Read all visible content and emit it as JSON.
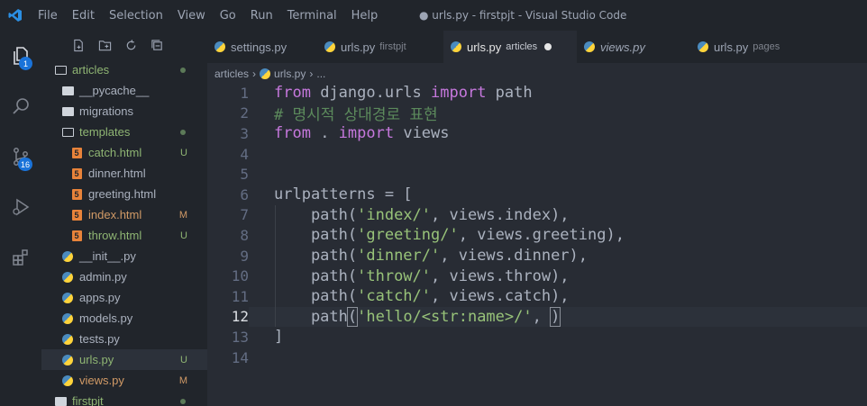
{
  "titlebar": {
    "menu": [
      "File",
      "Edit",
      "Selection",
      "View",
      "Go",
      "Run",
      "Terminal",
      "Help"
    ],
    "window_title": "● urls.py - firstpjt - Visual Studio Code"
  },
  "activity": {
    "source_control_badge": "16",
    "explorer_badge": "1"
  },
  "tabs": [
    {
      "name": "settings.py",
      "sub": ""
    },
    {
      "name": "urls.py",
      "sub": "firstpjt"
    },
    {
      "name": "urls.py",
      "sub": "articles",
      "active": true,
      "dirty": true
    },
    {
      "name": "views.py",
      "sub": ""
    },
    {
      "name": "urls.py",
      "sub": "pages"
    }
  ],
  "breadcrumb": {
    "folder": "articles",
    "file": "urls.py",
    "more": "..."
  },
  "explorer": [
    {
      "label": "articles",
      "type": "folder-open",
      "status": "dot"
    },
    {
      "label": "__pycache__",
      "type": "folder"
    },
    {
      "label": "migrations",
      "type": "folder"
    },
    {
      "label": "templates",
      "type": "folder-open",
      "status": "dot"
    },
    {
      "label": "catch.html",
      "type": "html",
      "status": "U"
    },
    {
      "label": "dinner.html",
      "type": "html"
    },
    {
      "label": "greeting.html",
      "type": "html"
    },
    {
      "label": "index.html",
      "type": "html",
      "status": "M"
    },
    {
      "label": "throw.html",
      "type": "html",
      "status": "U"
    },
    {
      "label": "__init__.py",
      "type": "py"
    },
    {
      "label": "admin.py",
      "type": "py"
    },
    {
      "label": "apps.py",
      "type": "py"
    },
    {
      "label": "models.py",
      "type": "py"
    },
    {
      "label": "tests.py",
      "type": "py"
    },
    {
      "label": "urls.py",
      "type": "py",
      "status": "U",
      "active": true
    },
    {
      "label": "views.py",
      "type": "py",
      "status": "M"
    },
    {
      "label": "firstpjt",
      "type": "folder",
      "status": "dot"
    }
  ],
  "colors": {
    "accent": "#1a73d9",
    "untracked": "#8fb573",
    "modified": "#d19a66"
  },
  "line_numbers": [
    "1",
    "2",
    "3",
    "4",
    "5",
    "6",
    "7",
    "8",
    "9",
    "10",
    "11",
    "12",
    "13",
    "14"
  ],
  "current_line": "12",
  "code": {
    "l1": {
      "kw1": "from",
      "mod": " django.urls ",
      "kw2": "import",
      "rest": " path"
    },
    "l2": "# 명시적 상대경로 표현",
    "l3": {
      "kw1": "from",
      "mod": " . ",
      "kw2": "import",
      "rest": " views"
    },
    "l6": "urlpatterns = [",
    "l7": {
      "pre": "    path(",
      "str": "'index/'",
      "post": ", views.index),"
    },
    "l8": {
      "pre": "    path(",
      "str": "'greeting/'",
      "post": ", views.greeting),"
    },
    "l9": {
      "pre": "    path(",
      "str": "'dinner/'",
      "post": ", views.dinner),"
    },
    "l10": {
      "pre": "    path(",
      "str": "'throw/'",
      "post": ", views.throw),"
    },
    "l11": {
      "pre": "    path(",
      "str": "'catch/'",
      "post": ", views.catch),"
    },
    "l12": {
      "pre": "    path",
      "open": "(",
      "str": "'hello/<str:name>/'",
      "mid": ", ",
      "close": ")"
    },
    "l13": "]"
  }
}
